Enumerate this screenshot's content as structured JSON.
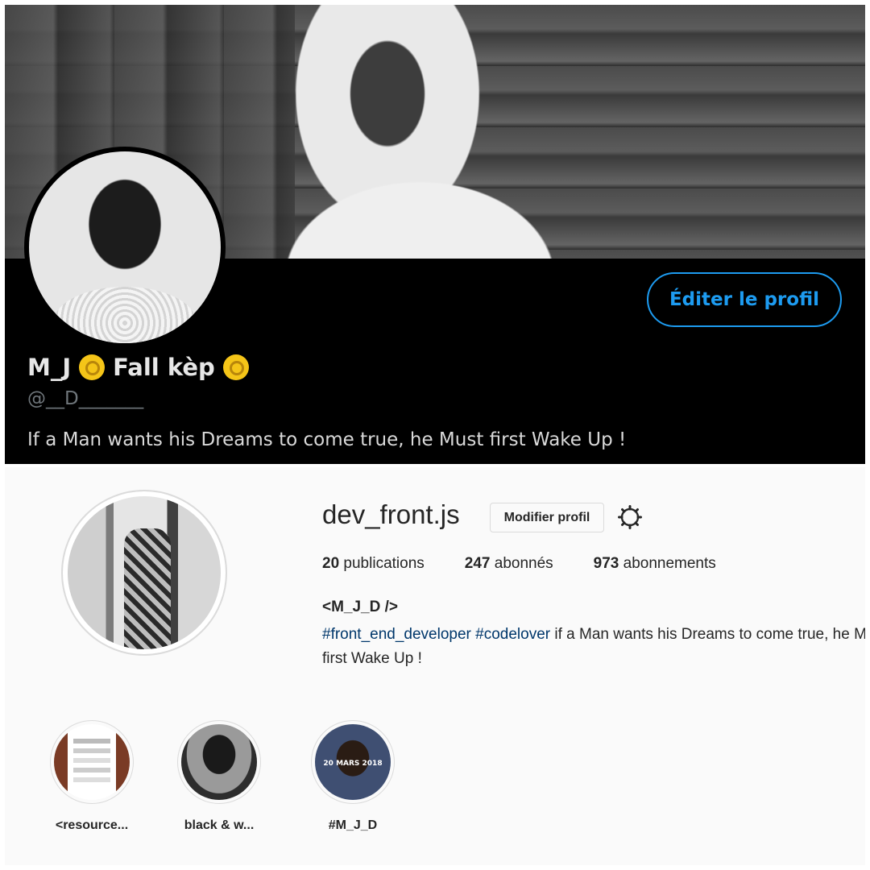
{
  "twitter": {
    "display_name": "M_J",
    "display_name_suffix": "Fall kèp",
    "handle": "@__D_______",
    "edit_button_label": "Éditer le profil",
    "bio": "If a Man wants his Dreams to come true, he Must first Wake Up !",
    "accent_color": "#1d9bf0"
  },
  "instagram": {
    "username": "dev_front.js",
    "edit_button_label": "Modifier profil",
    "settings_icon": "gear-icon",
    "stats": [
      {
        "count": "20",
        "label": "publications"
      },
      {
        "count": "247",
        "label": "abonnés"
      },
      {
        "count": "973",
        "label": "abonnements"
      }
    ],
    "full_name": "<M_J_D />",
    "bio_tags": "#front_end_developer #codelover",
    "bio_text_line1": "if a Man wants his Dreams to come true, he Must",
    "bio_text_line2": "first Wake Up !",
    "highlights": [
      {
        "label": "<resource..."
      },
      {
        "label": "black & w..."
      },
      {
        "label": "#M_J_D",
        "overlay_text": "20 MARS 2018"
      }
    ],
    "link_color": "#00376b"
  }
}
